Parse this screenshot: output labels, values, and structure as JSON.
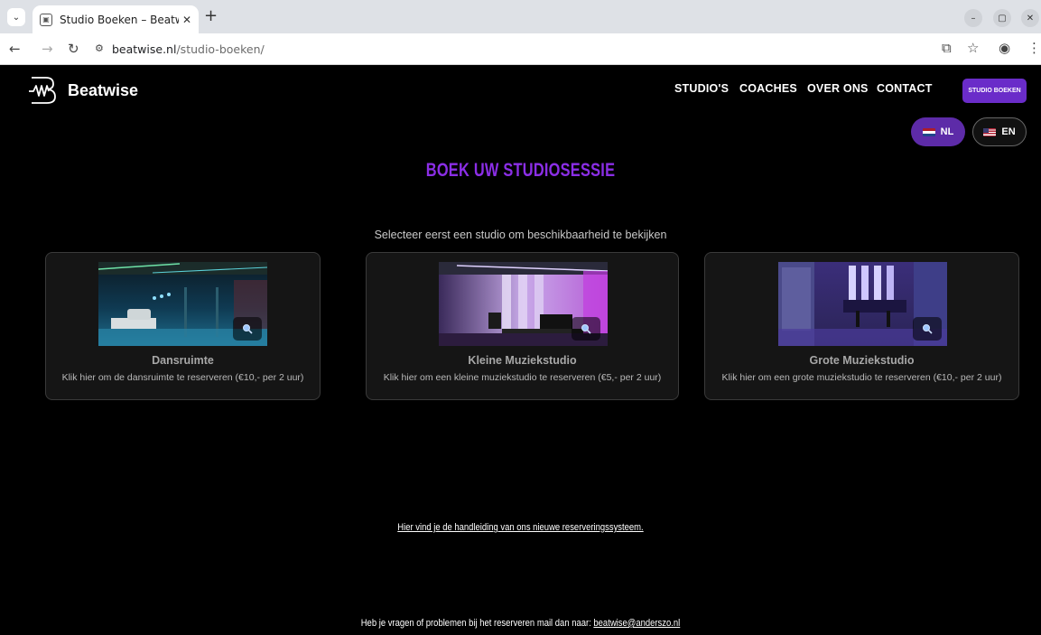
{
  "browser": {
    "tab_title": "Studio Boeken – Beatwis",
    "url_domain": "beatwise.nl",
    "url_path": "/studio-boeken/"
  },
  "site": {
    "logo_text": "Beatwise",
    "nav": [
      "STUDIO'S",
      "COACHES",
      "OVER ONS",
      "CONTACT"
    ],
    "cta_label": "STUDIO BOEKEN",
    "lang_nl": "NL",
    "lang_en": "EN"
  },
  "main": {
    "heading": "BOEK UW STUDIOSESSIE",
    "subtitle": "Selecteer eerst een studio om beschikbaarheid te bekijken",
    "studios": [
      {
        "name": "Dansruimte",
        "description": "Klik hier om de dansruimte te reserveren (€10,- per 2 uur)"
      },
      {
        "name": "Kleine Muziekstudio",
        "description": "Klik hier om een kleine muziekstudio te reserveren (€5,- per 2 uur)"
      },
      {
        "name": "Grote Muziekstudio",
        "description": "Klik hier om een grote muziekstudio te reserveren (€10,- per 2 uur)"
      }
    ],
    "guide_link": "Hier vind je de handleiding van ons nieuwe reserveringssysteem.",
    "footer_text": "Heb je vragen of problemen bij het reserveren mail dan naar:",
    "footer_email": "beatwise@anderszo.nl"
  },
  "colors": {
    "accent_purple": "#8b2ee6",
    "cta_purple": "#6a2cc9",
    "background": "#000000"
  }
}
